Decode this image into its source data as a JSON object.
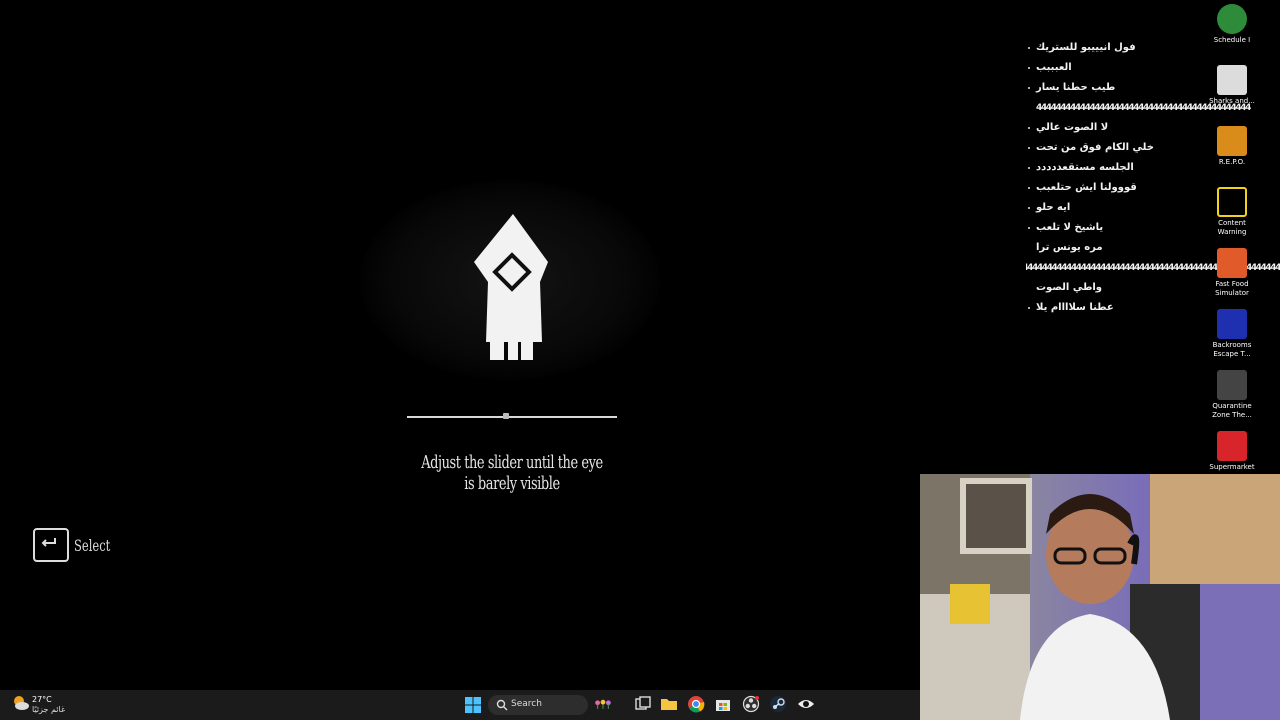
{
  "game": {
    "instruction": "Adjust the slider until the eye is barely visible",
    "select_label": "Select",
    "brightness_slider_value": 0.47
  },
  "chat": {
    "messages": [
      "فول انيييبو للستريك",
      "العبببب",
      "طيب حطنا يسار",
      "44444444444444444444444444444444444444444444",
      "لا الصوت عالي",
      "خلي الكام فوق من تحت",
      "الجلسه مستقعددددد",
      "قووولنا ايش حتلعبب",
      "ايه حلو",
      "ياشيخ لا تلعب",
      "مره يونس ترا",
      "44444444444444444444444444444444444444444444444444444444444444",
      "واطي الصوت",
      "عطنا سلاااام يلا"
    ]
  },
  "desktop": {
    "icons": [
      {
        "label": "Schedule I",
        "color": "#2e8b3a"
      },
      {
        "label": "Sharks and...",
        "color": "#dcdcdc"
      },
      {
        "label": "R.E.P.O.",
        "color": "#d98c1a"
      },
      {
        "label": "Content Warning",
        "color": "#f2d21b"
      },
      {
        "label": "Fast Food Simulator",
        "color": "#e05a2a"
      },
      {
        "label": "Backrooms Escape T...",
        "color": "#1e2fb0"
      },
      {
        "label": "Quarantine Zone The...",
        "color": "#444444"
      },
      {
        "label": "Supermarket",
        "color": "#d7252b"
      }
    ]
  },
  "taskbar": {
    "temperature": "27°C",
    "weather_condition": "غائم جزئيًا",
    "search_label": "Search"
  }
}
